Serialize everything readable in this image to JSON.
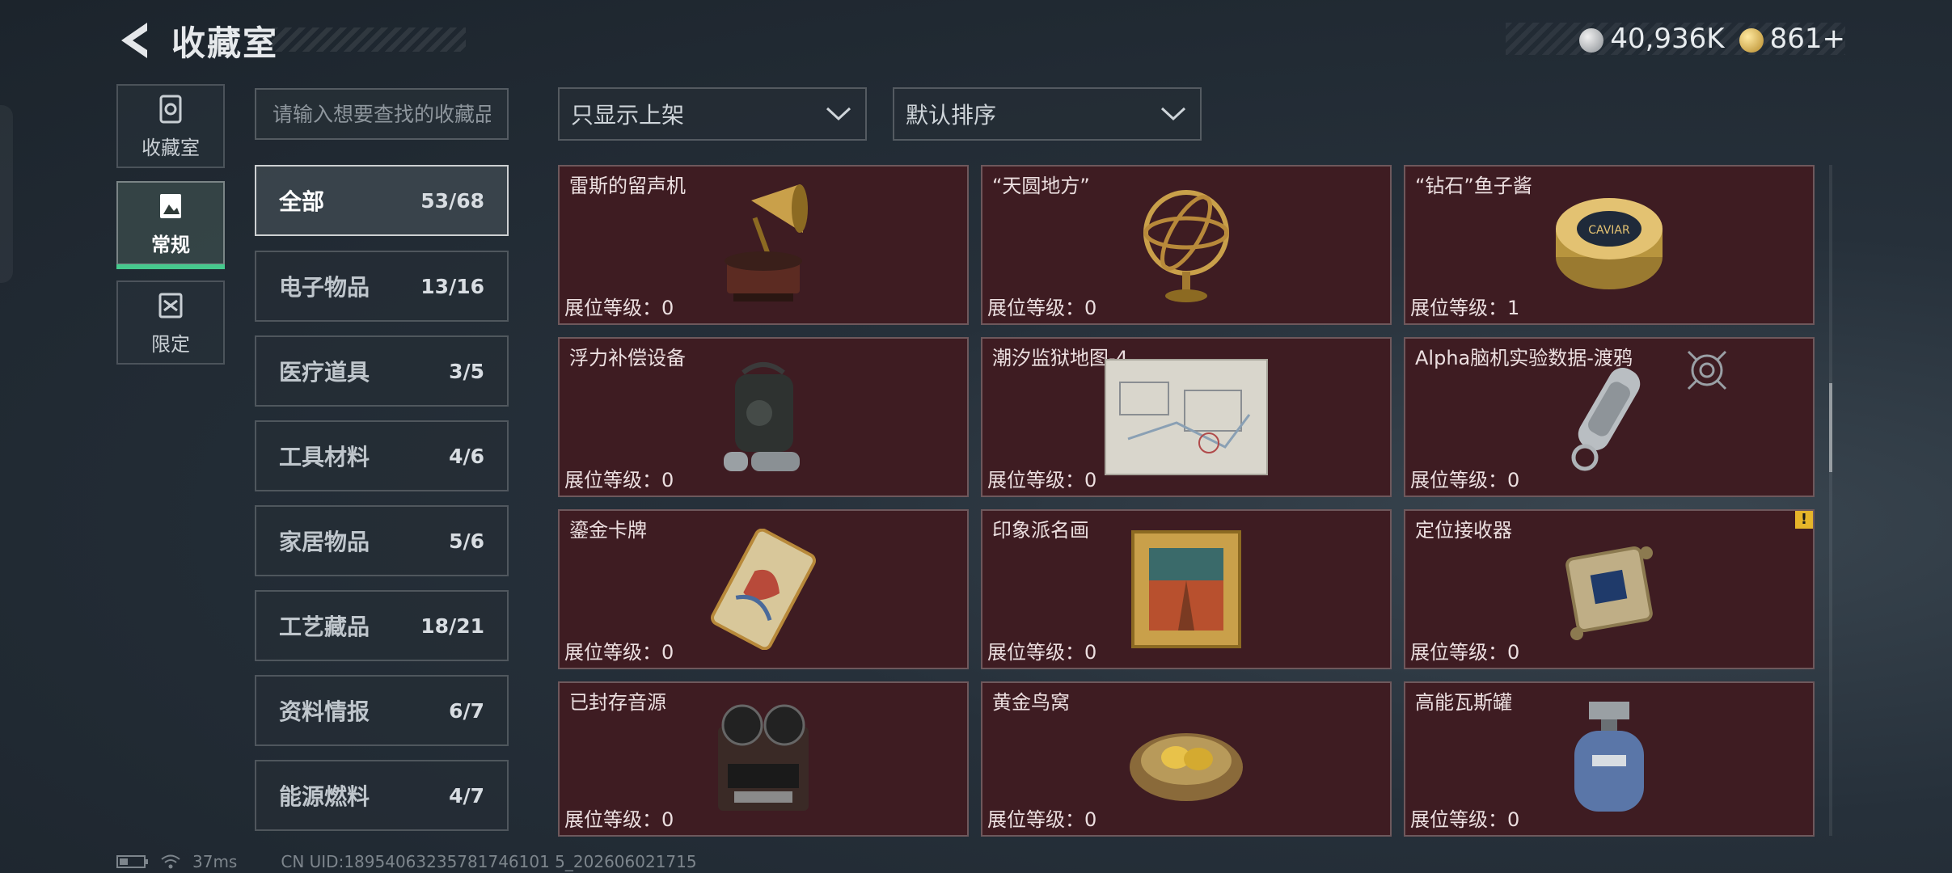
{
  "header": {
    "title": "收藏室"
  },
  "currency": {
    "silver": "40,936K",
    "gold": "861+"
  },
  "nav": [
    {
      "label": "收藏室",
      "icon": "vault-icon"
    },
    {
      "label": "常规",
      "icon": "gallery-icon",
      "active": true
    },
    {
      "label": "限定",
      "icon": "limited-icon"
    }
  ],
  "search": {
    "placeholder": "请输入想要查找的收藏品"
  },
  "categories": [
    {
      "name": "全部",
      "count": "53/68"
    },
    {
      "name": "电子物品",
      "count": "13/16"
    },
    {
      "name": "医疗道具",
      "count": "3/5"
    },
    {
      "name": "工具材料",
      "count": "4/6"
    },
    {
      "name": "家居物品",
      "count": "5/6"
    },
    {
      "name": "工艺藏品",
      "count": "18/21"
    },
    {
      "name": "资料情报",
      "count": "6/7"
    },
    {
      "name": "能源燃料",
      "count": "4/7"
    }
  ],
  "filters": {
    "display": "只显示上架",
    "sort": "默认排序"
  },
  "items": [
    {
      "name": "雷斯的留声机",
      "level": "展位等级：0",
      "icon": "gramophone-icon"
    },
    {
      "name": "“天圆地方”",
      "level": "展位等级：0",
      "icon": "armillary-sphere-icon"
    },
    {
      "name": "“钻石”鱼子酱",
      "level": "展位等级：1",
      "icon": "caviar-tin-icon",
      "tin_text": "CAVIAR"
    },
    {
      "name": "浮力补偿设备",
      "level": "展位等级：0",
      "icon": "buoyancy-device-icon"
    },
    {
      "name": "潮汐监狱地图-4",
      "level": "展位等级：0",
      "icon": "prison-map-icon"
    },
    {
      "name": "Alpha脑机实验数据-渡鸦",
      "level": "展位等级：0",
      "icon": "data-cylinder-icon"
    },
    {
      "name": "鎏金卡牌",
      "level": "展位等级：0",
      "icon": "gilded-card-icon"
    },
    {
      "name": "印象派名画",
      "level": "展位等级：0",
      "icon": "framed-painting-icon"
    },
    {
      "name": "定位接收器",
      "level": "展位等级：0",
      "icon": "locator-receiver-icon",
      "warning": "!"
    },
    {
      "name": "已封存音源",
      "level": "展位等级：0",
      "icon": "reel-recorder-icon"
    },
    {
      "name": "黄金鸟窝",
      "level": "展位等级：0",
      "icon": "golden-nest-icon"
    },
    {
      "name": "高能瓦斯罐",
      "level": "展位等级：0",
      "icon": "gas-canister-icon"
    }
  ],
  "footer": {
    "ping": "37ms",
    "uid": "CN UID:18954063235781746101 5_202606021715"
  },
  "colors": {
    "card_bg": "#3e1c22",
    "accent_green": "#46c98d"
  }
}
